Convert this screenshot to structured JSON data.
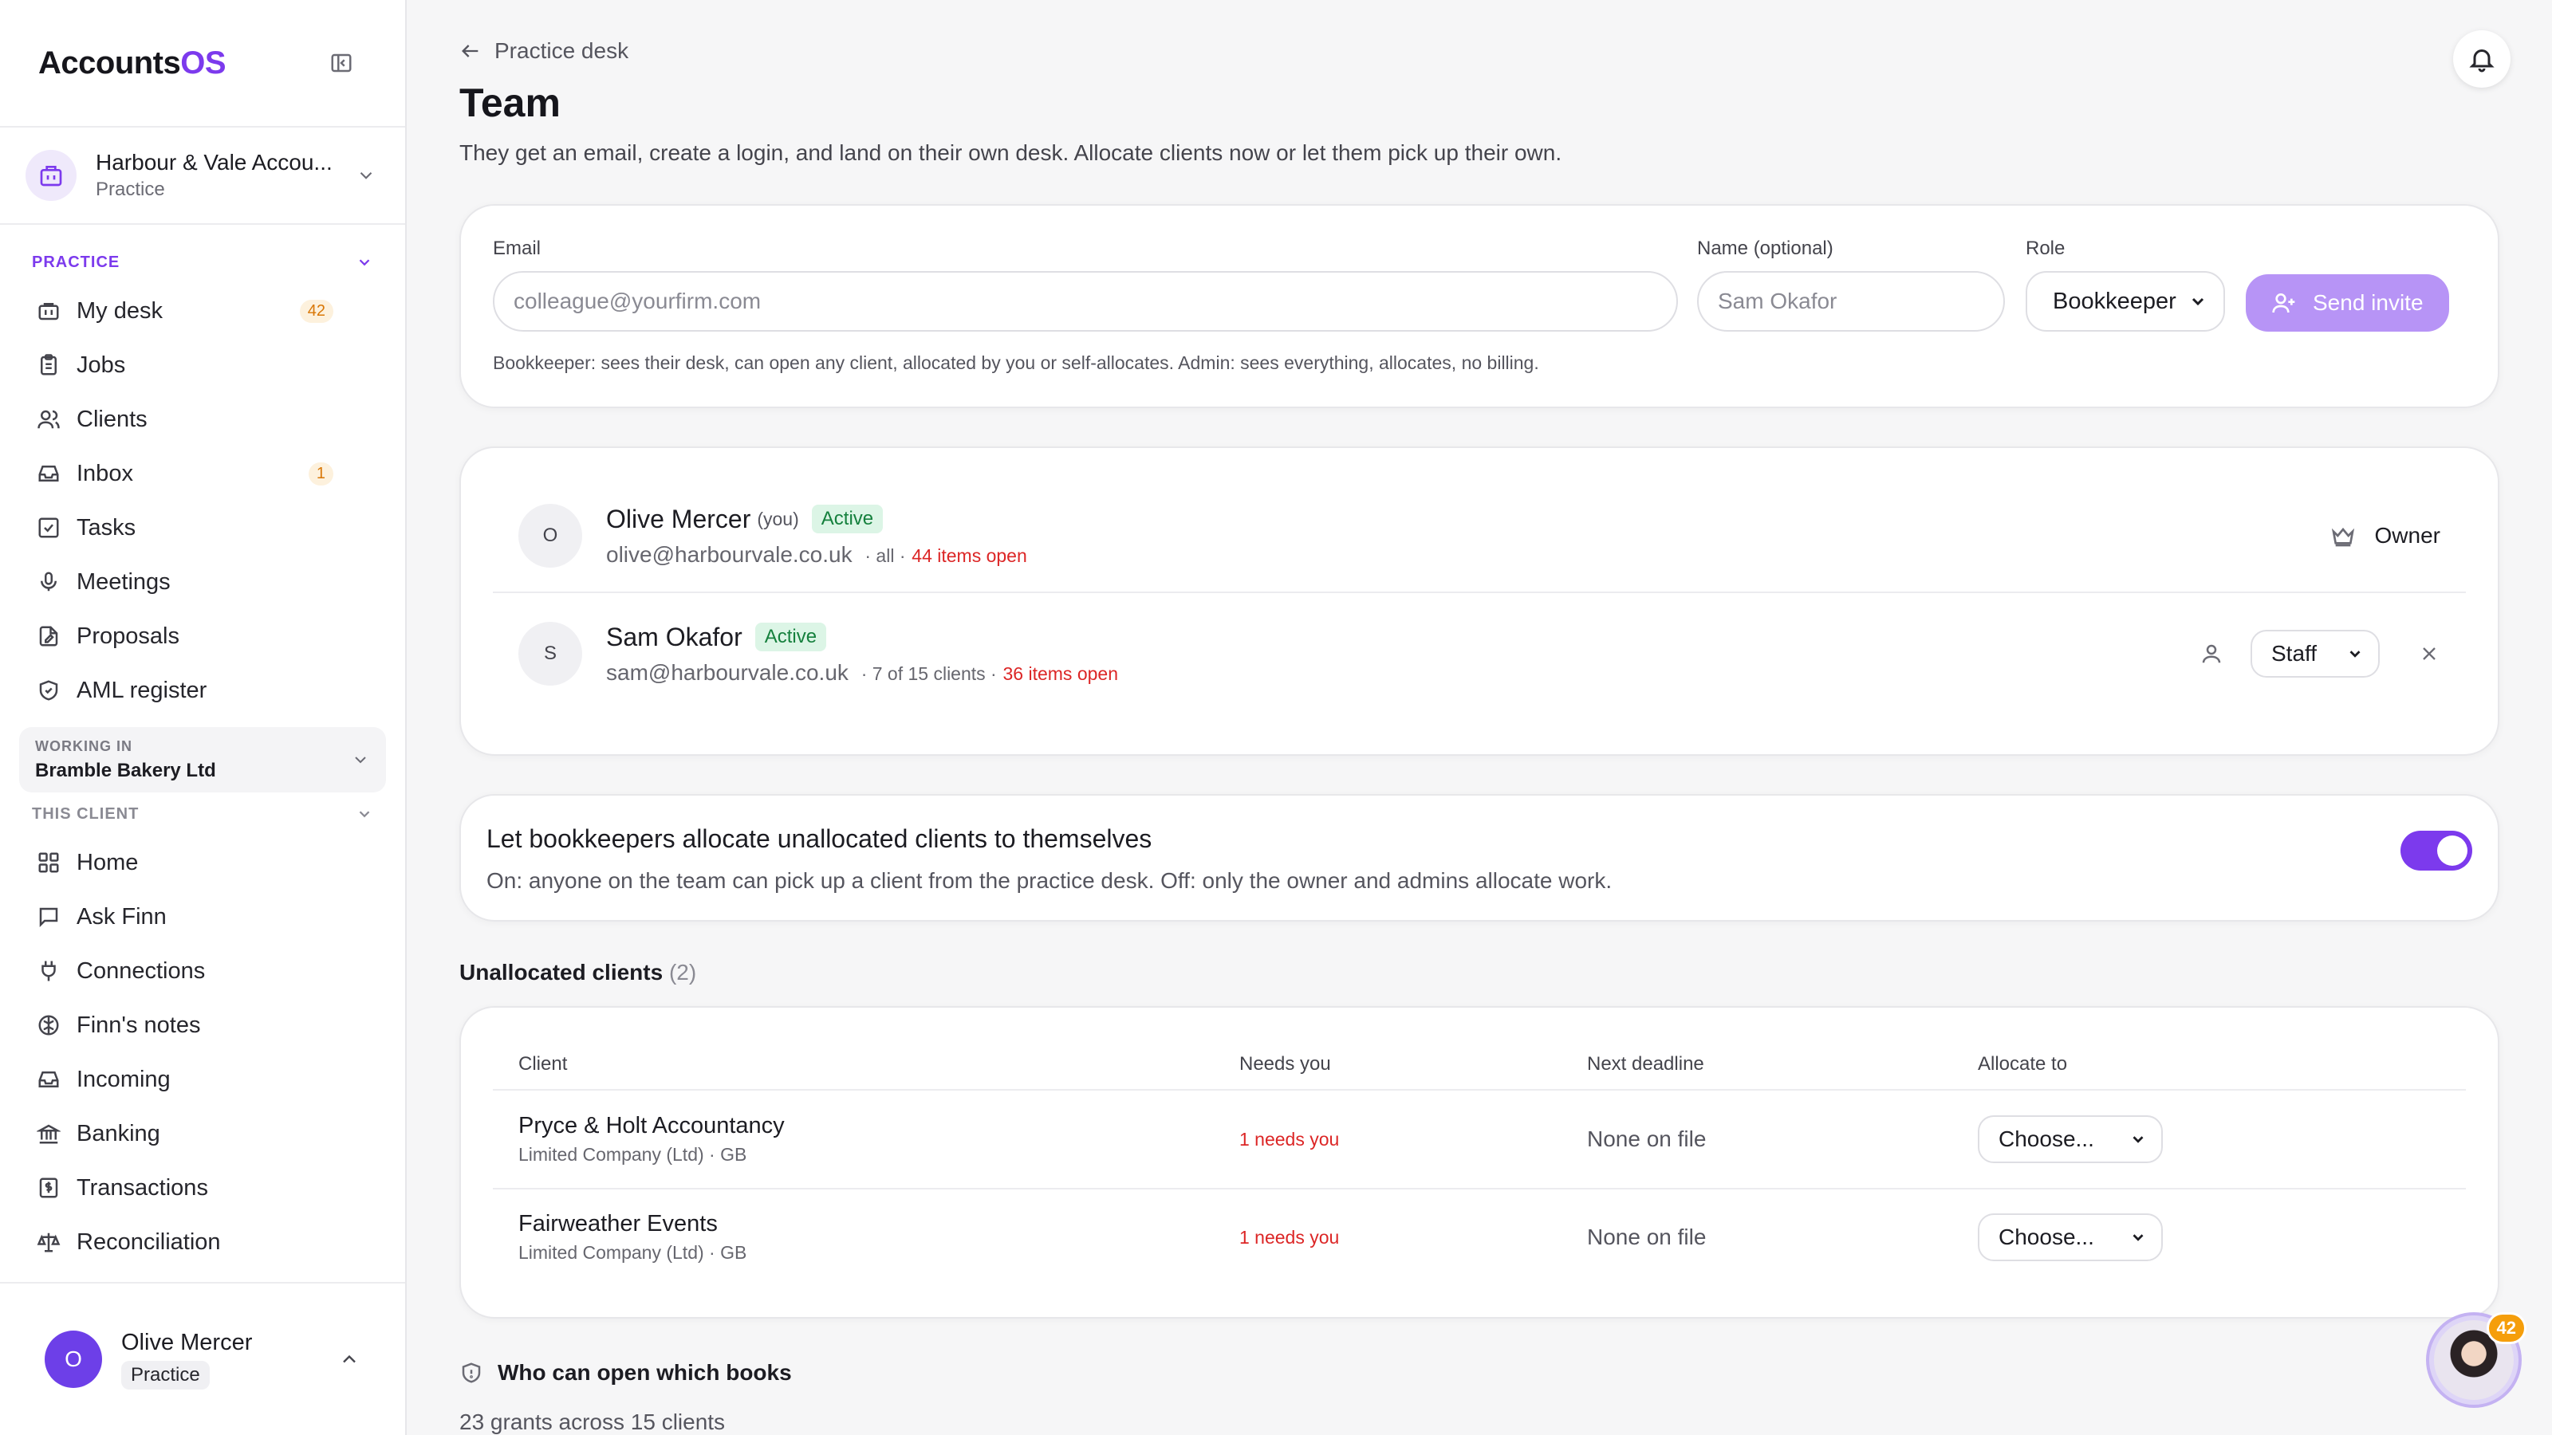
{
  "app": {
    "logo_main": "Accounts",
    "logo_accent": "OS"
  },
  "org": {
    "name": "Harbour & Vale Accou...",
    "type": "Practice"
  },
  "sidebar": {
    "practice_label": "PRACTICE",
    "practice_items": [
      {
        "label": "My desk",
        "icon": "briefcase-icon",
        "badge": "42"
      },
      {
        "label": "Jobs",
        "icon": "clipboard-icon"
      },
      {
        "label": "Clients",
        "icon": "users-icon"
      },
      {
        "label": "Inbox",
        "icon": "inbox-icon",
        "badge": "1"
      },
      {
        "label": "Tasks",
        "icon": "checkbox-icon"
      },
      {
        "label": "Meetings",
        "icon": "microphone-icon"
      },
      {
        "label": "Proposals",
        "icon": "document-edit-icon"
      },
      {
        "label": "AML register",
        "icon": "shield-check-icon"
      }
    ],
    "working_in_label": "WORKING IN",
    "working_in_value": "Bramble Bakery Ltd",
    "client_label": "THIS CLIENT",
    "client_items": [
      {
        "label": "Home",
        "icon": "grid-icon"
      },
      {
        "label": "Ask Finn",
        "icon": "chat-icon"
      },
      {
        "label": "Connections",
        "icon": "plug-icon"
      },
      {
        "label": "Finn's notes",
        "icon": "brain-icon"
      },
      {
        "label": "Incoming",
        "icon": "tray-icon"
      },
      {
        "label": "Banking",
        "icon": "bank-icon"
      },
      {
        "label": "Transactions",
        "icon": "receipt-icon"
      },
      {
        "label": "Reconciliation",
        "icon": "scale-icon"
      }
    ],
    "user": {
      "initial": "O",
      "name": "Olive Mercer",
      "role": "Practice"
    }
  },
  "header": {
    "back_label": "Practice desk",
    "title": "Team",
    "subtitle": "They get an email, create a login, and land on their own desk. Allocate clients now or let them pick up their own."
  },
  "invite": {
    "email_label": "Email",
    "email_placeholder": "colleague@yourfirm.com",
    "name_label": "Name (optional)",
    "name_placeholder": "Sam Okafor",
    "role_label": "Role",
    "role_value": "Bookkeeper",
    "send_label": "Send invite",
    "hint": "Bookkeeper: sees their desk, can open any client, allocated by you or self-allocates. Admin: sees everything, allocates, no billing."
  },
  "members": [
    {
      "initial": "O",
      "name": "Olive Mercer",
      "you": "(you)",
      "status": "Active",
      "email": "olive@harbourvale.co.uk",
      "scope": "· all ·",
      "open": "44 items open",
      "role": "Owner"
    },
    {
      "initial": "S",
      "name": "Sam Okafor",
      "status": "Active",
      "email": "sam@harbourvale.co.uk",
      "scope": "· 7 of 15 clients ·",
      "open": "36 items open",
      "role": "Staff"
    }
  ],
  "self_allocate": {
    "title": "Let bookkeepers allocate unallocated clients to themselves",
    "description": "On: anyone on the team can pick up a client from the practice desk. Off: only the owner and admins allocate work.",
    "enabled": true
  },
  "unallocated": {
    "title": "Unallocated clients",
    "count": "(2)",
    "columns": [
      "Client",
      "Needs you",
      "Next deadline",
      "Allocate to"
    ],
    "rows": [
      {
        "name": "Pryce & Holt Accountancy",
        "sub": "Limited Company (Ltd) · GB",
        "needs": "1 needs you",
        "deadline": "None on file",
        "allocate": "Choose..."
      },
      {
        "name": "Fairweather Events",
        "sub": "Limited Company (Ltd) · GB",
        "needs": "1 needs you",
        "deadline": "None on file",
        "allocate": "Choose..."
      }
    ]
  },
  "books": {
    "title": "Who can open which books",
    "summary": "23 grants across 15 clients"
  },
  "assistant": {
    "badge": "42"
  },
  "colors": {
    "accent": "#7c3aed",
    "danger": "#dc2626",
    "success": "#15803d"
  }
}
